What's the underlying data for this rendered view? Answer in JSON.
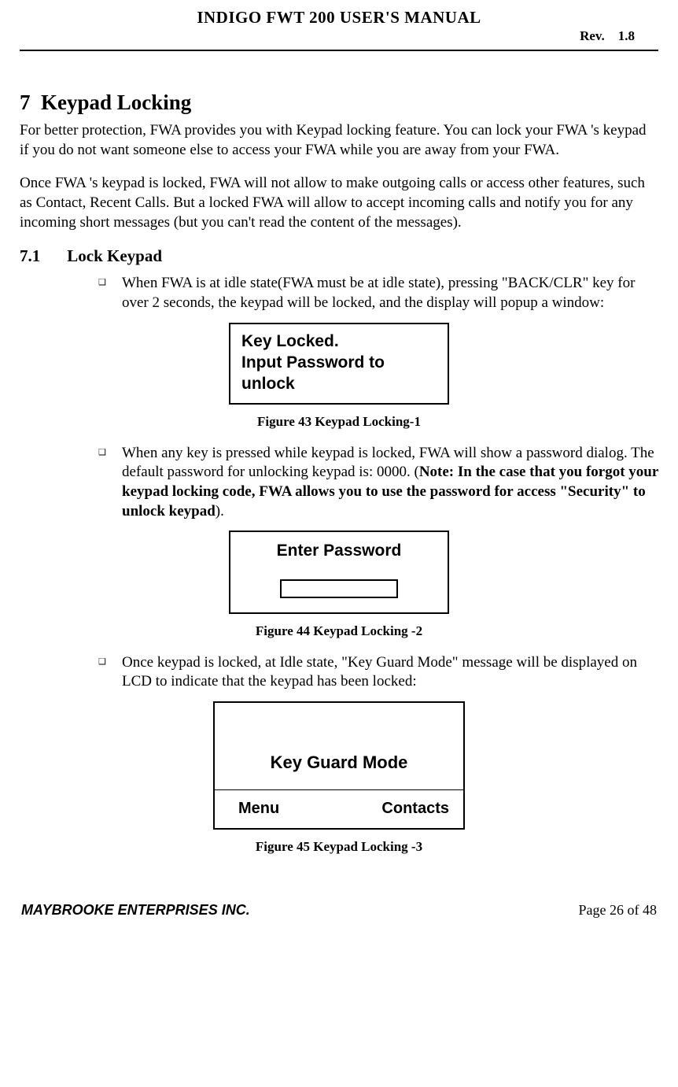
{
  "header": {
    "title": "INDIGO FWT 200 USER'S MANUAL",
    "rev_label": "Rev.",
    "rev_value": "1.8"
  },
  "section": {
    "number": "7",
    "title": "Keypad Locking",
    "intro_p1": "For better protection, FWA provides you with Keypad locking feature.  You can lock your FWA 's keypad if you do not want someone else to access your FWA while you are away from your FWA.",
    "intro_p2": "Once FWA 's keypad is locked,  FWA will not allow to make outgoing calls or access other features, such as Contact, Recent Calls.  But a locked FWA will allow to accept incoming calls and notify you for any incoming short messages (but you can't read the content of the messages)."
  },
  "subsection": {
    "number": "7.1",
    "title": "Lock Keypad",
    "bullets": {
      "b1": "When FWA is at idle state(FWA must be at idle state), pressing \"BACK/CLR\" key for over 2 seconds, the keypad will be locked, and the display will popup a window:",
      "b2_pre": "When any key is pressed while keypad is locked, FWA will show a password dialog. The default password for unlocking keypad is: 0000. (",
      "b2_bold": "Note: In the case that you forgot your keypad locking code, FWA allows you to use the password for access \"Security\" to unlock keypad",
      "b2_post": ").",
      "b3": "Once keypad is locked, at Idle state,  \"Key Guard Mode\" message will be displayed on LCD to indicate that the keypad has been locked:"
    }
  },
  "dialogs": {
    "d1_line1": "Key Locked.",
    "d1_line2": "Input Password to unlock",
    "d2_title": "Enter Password",
    "d3_message": "Key Guard Mode",
    "d3_left": "Menu",
    "d3_right": "Contacts"
  },
  "figures": {
    "f1": "Figure 43  Keypad Locking-1",
    "f2": "Figure 44  Keypad Locking -2",
    "f3": "Figure 45  Keypad Locking -3"
  },
  "footer": {
    "company": "MAYBROOKE ENTERPRISES INC.",
    "page": "Page 26 of 48"
  }
}
